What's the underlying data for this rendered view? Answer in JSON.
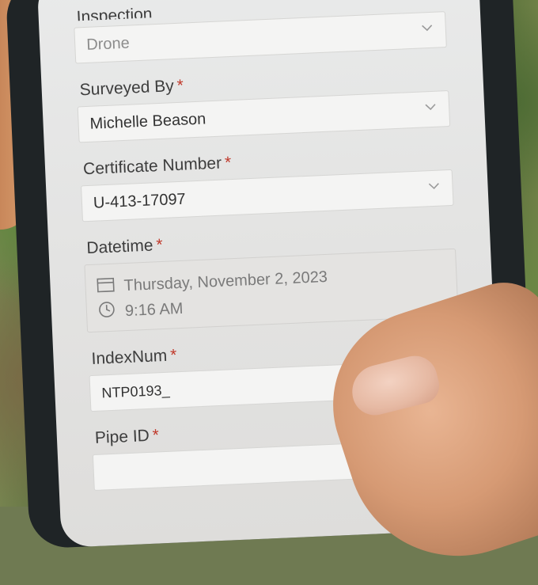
{
  "form": {
    "top_field": {
      "label": "Inspection",
      "value": "Drone"
    },
    "surveyed_by": {
      "label": "Surveyed By",
      "required_marker": "*",
      "value": "Michelle Beason"
    },
    "certificate_number": {
      "label": "Certificate Number",
      "required_marker": "*",
      "value": "U-413-17097"
    },
    "datetime": {
      "label": "Datetime",
      "required_marker": "*",
      "date": "Thursday, November 2, 2023",
      "time": "9:16 AM"
    },
    "index_num": {
      "label": "IndexNum",
      "required_marker": "*",
      "value": "NTP0193_"
    },
    "pipe_id": {
      "label": "Pipe ID",
      "required_marker": "*",
      "value": ""
    }
  },
  "icons": {
    "dropdown": "chevron-down-icon",
    "calendar": "calendar-icon",
    "clock": "clock-icon",
    "clear": "clear-circle-icon"
  },
  "colors": {
    "required": "#c0392b",
    "screen_bg": "#e6e6e5",
    "phone_case": "#1f2426"
  }
}
